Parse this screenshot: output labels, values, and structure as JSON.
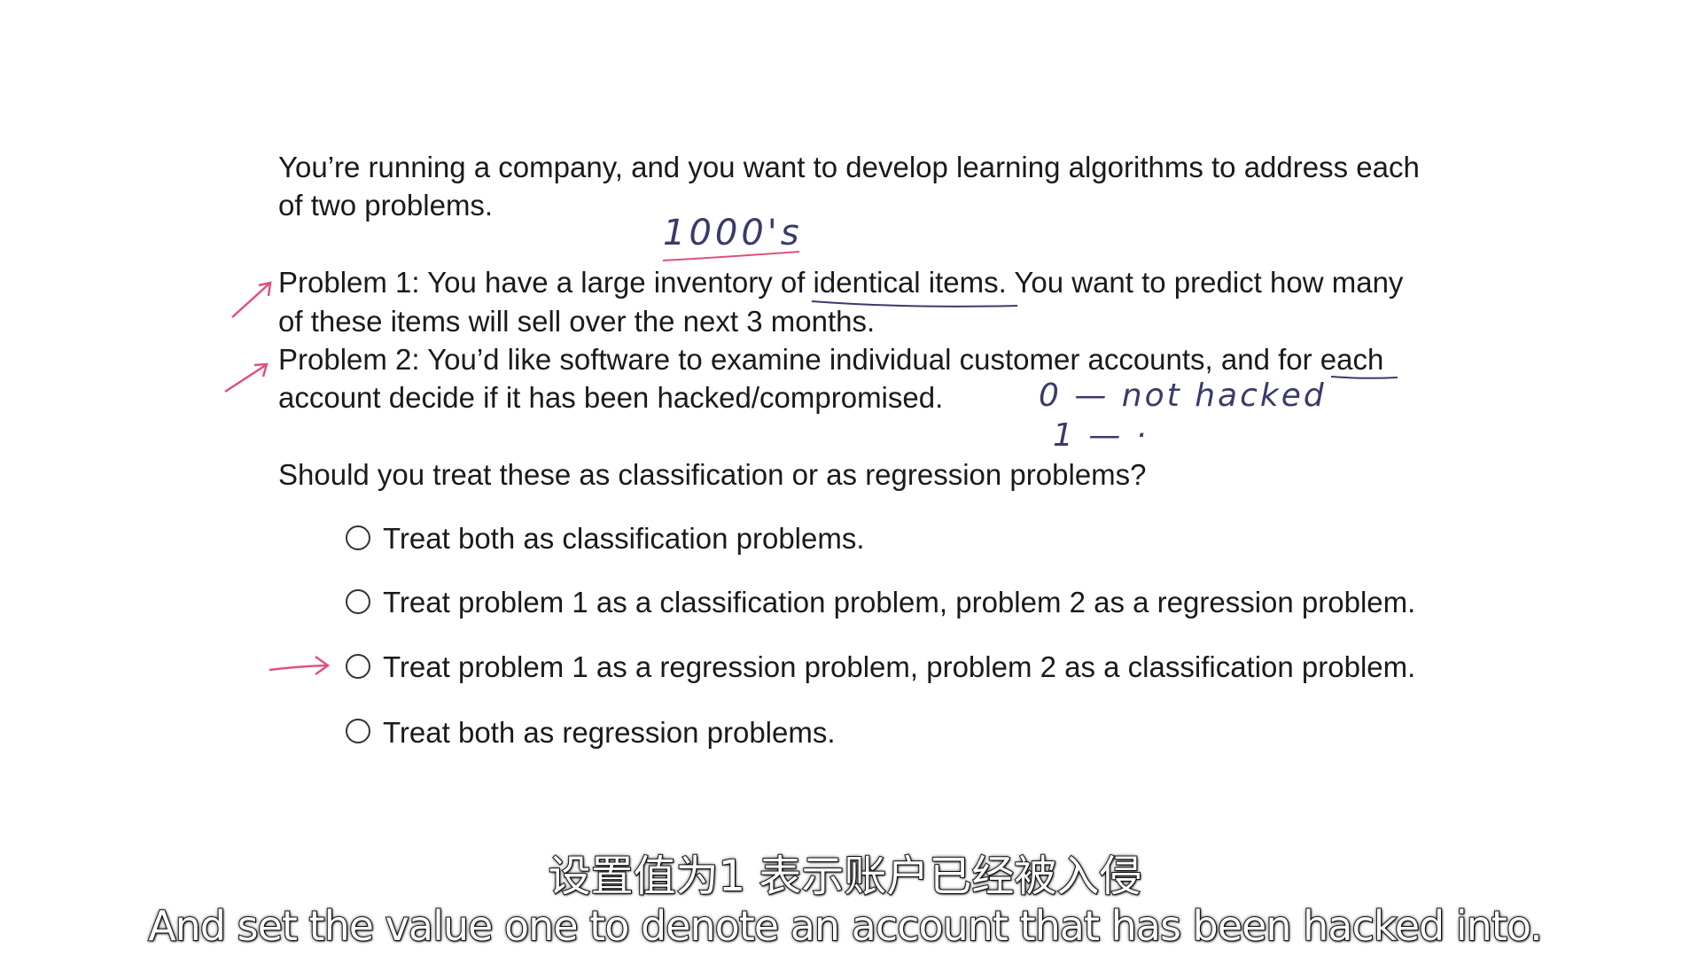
{
  "slide": {
    "intro_line1": "You’re running a company, and you want to develop learning algorithms to address each",
    "intro_line2": "of two problems.",
    "p1_line1": "Problem 1: You have a large inventory of identical items.  You want to predict how many",
    "p1_line2": "of these items will sell over the next 3 months.",
    "p2_line1": "Problem 2: You’d like software to examine individual customer accounts, and for each",
    "p2_line2": "account decide if it has been hacked/compromised.",
    "question": "Should you treat these as classification or as regression problems?",
    "options": [
      {
        "label": "Treat both as classification problems.",
        "selected": false
      },
      {
        "label": "Treat problem 1 as a classification problem, problem 2 as a regression problem.",
        "selected": false
      },
      {
        "label": "Treat problem 1 as a regression problem, problem 2 as a classification problem.",
        "selected": false
      },
      {
        "label": "Treat both as regression problems.",
        "selected": false
      }
    ]
  },
  "annotations": {
    "note_thousands": "1000's",
    "note_zero_label": "0 — not hacked",
    "note_one_label": "1 — ·",
    "ink_color_pink": "#e0507a",
    "ink_color_dark": "#3a3a6a"
  },
  "subtitles": {
    "chinese": "设置值为1 表示账户已经被入侵",
    "english": "And set the value one to denote an account that has been hacked into."
  }
}
